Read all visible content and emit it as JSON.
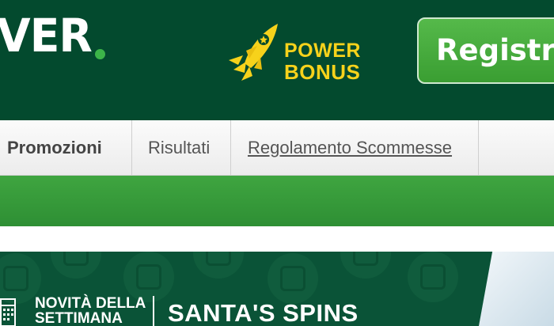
{
  "header": {
    "logo_text": "VER",
    "powerbonus": {
      "line1": "POWER",
      "line2": "BONUS"
    },
    "register_label": "Registra"
  },
  "nav": {
    "items": [
      {
        "label": "Promozioni"
      },
      {
        "label": "Risultati"
      },
      {
        "label": "Regolamento Scommesse"
      }
    ]
  },
  "banner": {
    "tag_line1": "NOVITÀ DELLA",
    "tag_line2": "SETTIMANA",
    "title": "SANTA'S SPINS"
  },
  "colors": {
    "header_bg": "#034a2e",
    "brand_green": "#3cb449",
    "bonus_yellow": "#f7d21b",
    "register_green": "#4caf43",
    "nav_green_bar": "#37a03b",
    "banner_bg": "#0a5337"
  }
}
